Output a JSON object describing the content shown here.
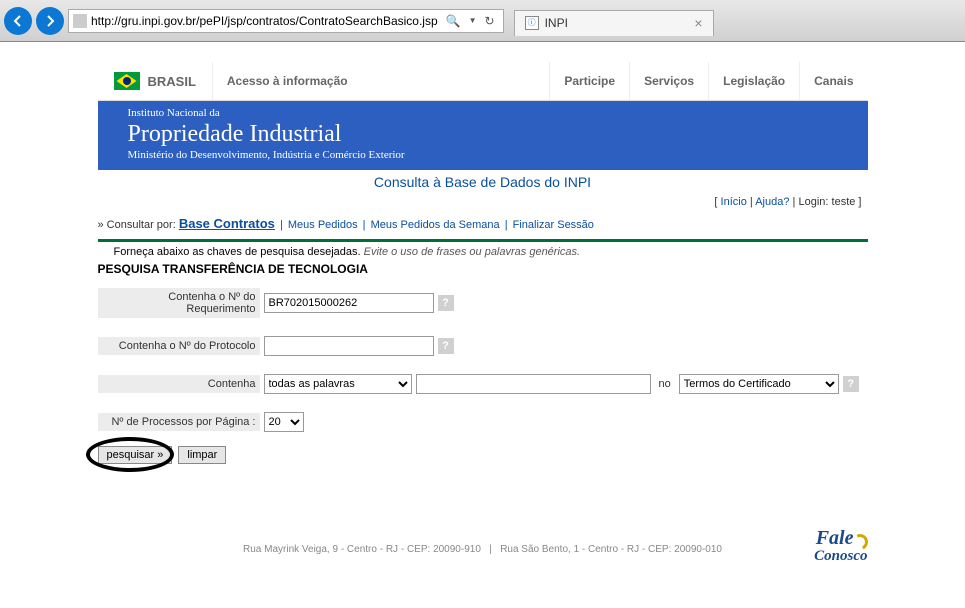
{
  "browser": {
    "url": "http://gru.inpi.gov.br/pePI/jsp/contratos/ContratoSearchBasico.jsp",
    "tab_title": "INPI"
  },
  "gov_bar": {
    "brasil": "BRASIL",
    "acesso": "Acesso à informação",
    "participe": "Participe",
    "servicos": "Serviços",
    "legislacao": "Legislação",
    "canais": "Canais"
  },
  "header": {
    "line1": "Instituto Nacional da",
    "line2": "Propriedade Industrial",
    "line3": "Ministério do Desenvolvimento, Indústria e Comércio Exterior",
    "consulta": "Consulta à Base de Dados do INPI"
  },
  "top_links": {
    "inicio": "Início",
    "ajuda": "Ajuda?",
    "login_label": "Login:",
    "login_value": "teste"
  },
  "nav": {
    "prefix": "» Consultar por:",
    "base": "Base Contratos",
    "meus_pedidos": "Meus Pedidos",
    "meus_pedidos_semana": "Meus Pedidos da Semana",
    "finalizar": "Finalizar Sessão"
  },
  "instructions": {
    "text1": "Forneça abaixo as chaves de pesquisa desejadas.",
    "text2": "Evite o uso de frases ou palavras genéricas."
  },
  "section_title": "PESQUISA TRANSFERÊNCIA DE TECNOLOGIA",
  "form": {
    "req_label": "Contenha o Nº do Requerimento",
    "req_value": "BR702015000262",
    "proto_label": "Contenha o Nº do Protocolo",
    "proto_value": "",
    "contenha_label": "Contenha",
    "contenha_select": "todas as palavras",
    "contenha_text": "",
    "no_label": "no",
    "termos_select": "Termos do Certificado",
    "per_page_label": "Nº de Processos por Página :",
    "per_page_value": "20"
  },
  "buttons": {
    "pesquisar": "pesquisar »",
    "limpar": "limpar"
  },
  "footer": {
    "addr1": "Rua Mayrink Veiga, 9 - Centro - RJ - CEP: 20090-910",
    "sep": "|",
    "addr2": "Rua São Bento, 1 - Centro - RJ - CEP: 20090-010",
    "fale": "Fale",
    "conosco": "Conosco"
  }
}
